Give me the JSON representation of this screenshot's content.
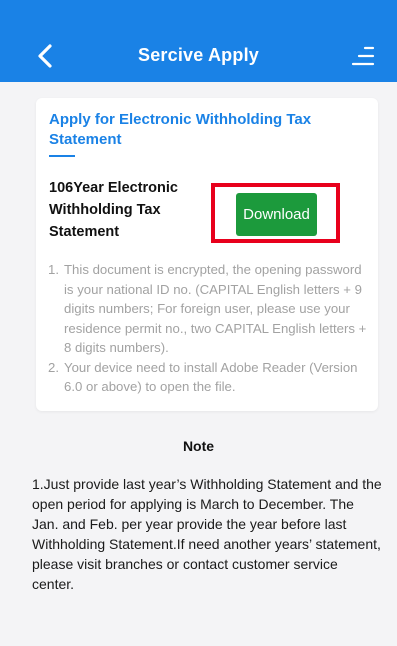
{
  "header": {
    "title": "Sercive Apply",
    "back_icon": "chevron-left-icon",
    "menu_icon": "menu-icon",
    "background": "#1a82e6"
  },
  "card": {
    "title": "Apply for Electronic Withholding Tax Statement",
    "document_name": "106Year Electronic Withholding Tax Statement",
    "download_label": "Download",
    "download_color": "#1c9a3c",
    "highlight_color": "#e8001c",
    "instructions": [
      {
        "num": "1.",
        "text": "This document is encrypted, the opening password is your national ID no. (CAPITAL English letters + 9 digits numbers; For foreign user, please use your residence permit no., two CAPITAL English letters + 8 digits numbers)."
      },
      {
        "num": "2.",
        "text": "Your device need to install Adobe Reader (Version 6.0 or above) to open the file."
      }
    ]
  },
  "note": {
    "title": "Note",
    "text": "1.Just provide last year’s Withholding Statement and the open period for applying is March to December. The Jan. and Feb. per year provide the year before last Withholding Statement.If need another years’ statement, please visit branches or contact customer service center."
  }
}
